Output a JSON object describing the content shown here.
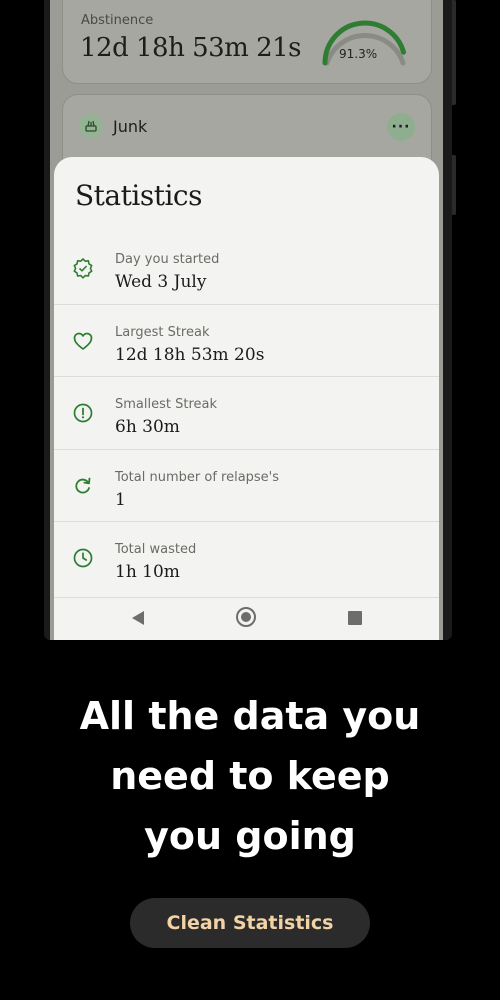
{
  "background_card": {
    "label": "Abstinence",
    "timer": "12d 18h 53m 21s",
    "progress_text": "91.3%",
    "progress_value": 0.913,
    "accent": "#2f7d32"
  },
  "habit_card": {
    "icon": "junk-food-icon",
    "label": "Junk",
    "menu_label": "···"
  },
  "statistics": {
    "title": "Statistics",
    "items": [
      {
        "icon": "badge-check-icon",
        "label": "Day you started",
        "value": "Wed 3 July"
      },
      {
        "icon": "heart-icon",
        "label": "Largest Streak",
        "value": "12d 18h 53m 20s"
      },
      {
        "icon": "alert-circle-icon",
        "label": "Smallest Streak",
        "value": "6h 30m"
      },
      {
        "icon": "refresh-icon",
        "label": "Total number of relapse's",
        "value": "1"
      },
      {
        "icon": "clock-icon",
        "label": "Total wasted",
        "value": "1h 10m"
      }
    ],
    "icon_color": "#2e7d32"
  },
  "navbar": {
    "back": "back-triangle-icon",
    "home": "home-circle-icon",
    "recent": "recent-square-icon"
  },
  "promo": {
    "line1": "All the data you",
    "line2": "need to keep",
    "line3": "you going",
    "cta_label": "Clean Statistics",
    "cta_color": "#f2d3a6"
  }
}
